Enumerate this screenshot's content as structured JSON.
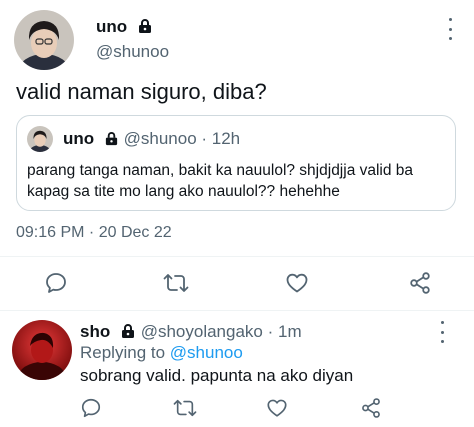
{
  "main_tweet": {
    "display_name": "uno",
    "handle": "@shunoo",
    "text": "valid naman siguro, diba?",
    "timestamp": "09:16 PM · 20 Dec 22",
    "quoted": {
      "display_name": "uno",
      "handle": "@shunoo",
      "time": "· 12h",
      "text": "parang tanga naman, bakit ka nauulol? shjdjdjja valid ba kapag sa tite mo lang ako nauulol?? hehehhe"
    }
  },
  "reply": {
    "display_name": "sho",
    "handle": "@shoyolangako",
    "time": "· 1m",
    "replying_prefix": "Replying to",
    "replying_handle": "@shunoo",
    "text": "sobrang valid. papunta na ako diyan"
  },
  "actions": [
    "reply-icon",
    "retweet-icon",
    "like-icon",
    "share-icon"
  ],
  "colors": {
    "link": "#1d9bf0",
    "muted": "#536471",
    "text": "#0f1419"
  }
}
